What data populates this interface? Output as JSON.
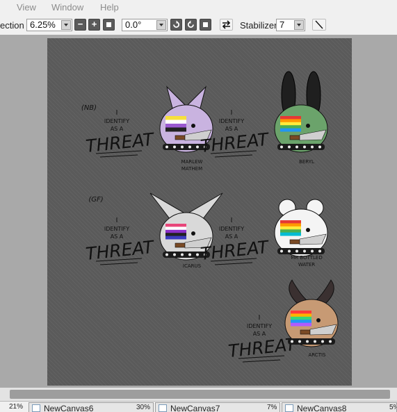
{
  "menu": {
    "items": [
      "View",
      "Window",
      "Help"
    ]
  },
  "toolbar": {
    "correction_label": "ection",
    "zoom_value": "6.25%",
    "rotation_value": "0.0°",
    "stabilizer_label": "Stabilizer",
    "stabilizer_value": "7",
    "minus_glyph": "−",
    "plus_glyph": "+"
  },
  "artwork": {
    "motto": [
      "I",
      "IDENTIFY",
      "AS A",
      "THREAT"
    ],
    "groups": [
      {
        "tag": "(NB)"
      },
      {
        "tag": "(GF)"
      }
    ],
    "characters": [
      {
        "name": [
          "MARLEW",
          "MATHEM"
        ],
        "fur": "#c9b3e0",
        "accent": "#6a4a8a",
        "flag": [
          "#f7e03d",
          "#ffffff",
          "#9b59d0",
          "#222222"
        ]
      },
      {
        "name": [
          "BERYL"
        ],
        "fur": "#6ba36b",
        "accent": "#1f1f1f",
        "flag": [
          "#e53935",
          "#ff9800",
          "#ffeb3b",
          "#4caf50",
          "#2196f3"
        ]
      },
      {
        "name": [
          "ICARUS"
        ],
        "fur": "#d9d9d9",
        "accent": "#333333",
        "flag": [
          "#e8457a",
          "#ffffff",
          "#8b2fc9",
          "#222222",
          "#3b3bbf"
        ]
      },
      {
        "name": [
          "MR BOTTLED",
          "WATER"
        ],
        "fur": "#f4f4f4",
        "accent": "#4ec9b0",
        "flag": [
          "#e53935",
          "#ff9800",
          "#ffeb3b",
          "#4caf50",
          "#00bcd4"
        ]
      },
      {
        "name": [
          "ARCTIS"
        ],
        "fur": "#c79a74",
        "accent": "#3a3030",
        "flag": [
          "#ff3b3b",
          "#ffb400",
          "#37d67a",
          "#2196f3",
          "#b05cff"
        ]
      }
    ]
  },
  "tabs": [
    {
      "left_zoom": "21%",
      "name": "NewCanvas6",
      "zoom": "30%"
    },
    {
      "name": "NewCanvas7",
      "zoom": "7%"
    },
    {
      "name": "NewCanvas8",
      "zoom": "5%"
    }
  ]
}
